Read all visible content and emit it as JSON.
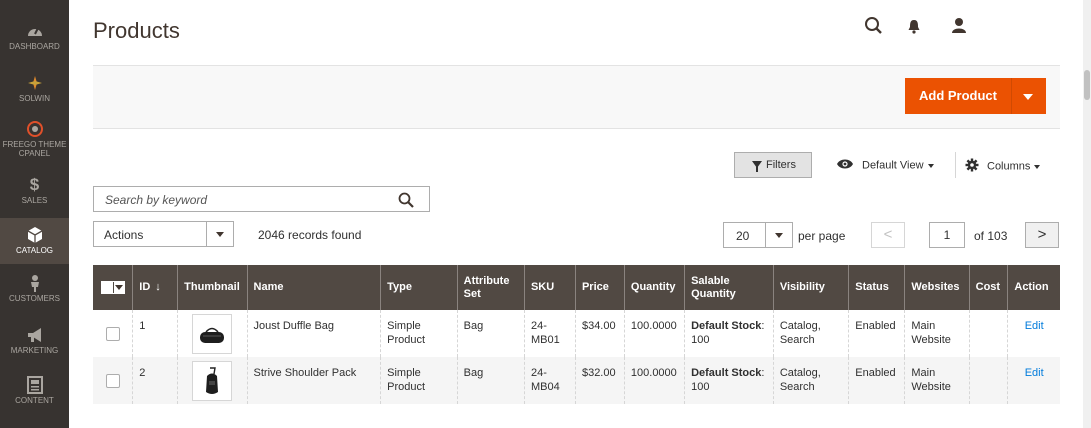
{
  "sidebar": {
    "items": [
      {
        "label": "DASHBOARD",
        "icon": "dashboard-icon"
      },
      {
        "label": "SOLWIN",
        "icon": "solwin-icon"
      },
      {
        "label": "FREEGO THEME CPANEL",
        "icon": "theme-panel-icon"
      },
      {
        "label": "SALES",
        "icon": "dollar-icon"
      },
      {
        "label": "CATALOG",
        "icon": "cube-icon",
        "active": true
      },
      {
        "label": "CUSTOMERS",
        "icon": "person-icon"
      },
      {
        "label": "MARKETING",
        "icon": "megaphone-icon"
      },
      {
        "label": "CONTENT",
        "icon": "content-icon"
      }
    ]
  },
  "header": {
    "title": "Products"
  },
  "actionbar": {
    "add_product_label": "Add Product"
  },
  "toolbar": {
    "filters_label": "Filters",
    "view_label": "Default View",
    "columns_label": "Columns"
  },
  "search": {
    "placeholder": "Search by keyword"
  },
  "grid_controls": {
    "actions_label": "Actions",
    "records_found": "2046 records found",
    "per_page_value": "20",
    "per_page_label": "per page",
    "page_prev": "<",
    "page_current": "1",
    "page_total": "of 103",
    "page_next": ">"
  },
  "table": {
    "headers": {
      "id": "ID",
      "id_sort": "↓",
      "thumbnail": "Thumbnail",
      "name": "Name",
      "type": "Type",
      "attribute_set": "Attribute Set",
      "sku": "SKU",
      "price": "Price",
      "quantity": "Quantity",
      "salable_quantity": "Salable Quantity",
      "visibility": "Visibility",
      "status": "Status",
      "websites": "Websites",
      "cost": "Cost",
      "action": "Action"
    },
    "rows": [
      {
        "id": "1",
        "name": "Joust Duffle Bag",
        "type": "Simple Product",
        "attribute_set": "Bag",
        "sku": "24-MB01",
        "price": "$34.00",
        "quantity": "100.0000",
        "salable_label": "Default Stock",
        "salable_value": ": 100",
        "visibility": "Catalog, Search",
        "status": "Enabled",
        "websites": "Main Website",
        "cost": "",
        "action": "Edit",
        "thumbnail": "duffle-bag-image"
      },
      {
        "id": "2",
        "name": "Strive Shoulder Pack",
        "type": "Simple Product",
        "attribute_set": "Bag",
        "sku": "24-MB04",
        "price": "$32.00",
        "quantity": "100.0000",
        "salable_label": "Default Stock",
        "salable_value": ": 100",
        "visibility": "Catalog, Search",
        "status": "Enabled",
        "websites": "Main Website",
        "cost": "",
        "action": "Edit",
        "thumbnail": "shoulder-pack-image"
      }
    ]
  },
  "colors": {
    "sidebar_bg": "#373330",
    "accent": "#eb5202",
    "table_header_bg": "#514943",
    "link": "#007bdb"
  }
}
